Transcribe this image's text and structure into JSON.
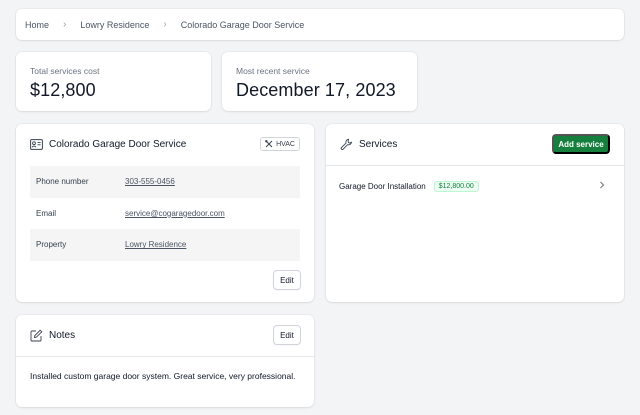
{
  "breadcrumb": {
    "items": [
      "Home",
      "Lowry Residence",
      "Colorado Garage Door Service"
    ]
  },
  "stats": {
    "total_label": "Total services cost",
    "total_value": "$12,800",
    "recent_label": "Most recent service",
    "recent_value": "December 17, 2023"
  },
  "vendor": {
    "title": "Colorado Garage Door Service",
    "tag": "HVAC",
    "phone_label": "Phone number",
    "phone_value": "303-555-0456",
    "email_label": "Email",
    "email_value": "service@cogaragedoor.com",
    "property_label": "Property",
    "property_value": "Lowry Residence",
    "edit_label": "Edit"
  },
  "services": {
    "title": "Services",
    "add_label": "Add service",
    "items": [
      {
        "name": "Garage Door Installation",
        "price": "$12,800.00"
      }
    ]
  },
  "notes": {
    "title": "Notes",
    "edit_label": "Edit",
    "text": "Installed custom garage door system. Great service, very professional."
  },
  "colors": {
    "accent": "#15803d",
    "badge_bg": "#ecfdf3",
    "background": "#f3f4f6"
  }
}
